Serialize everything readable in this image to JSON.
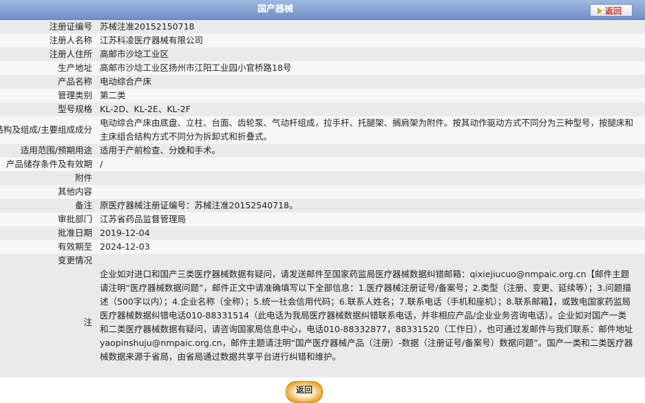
{
  "header": {
    "title": "国产器械",
    "back_label": "返回"
  },
  "fields": {
    "reg_no": {
      "label": "注册证编号",
      "value": "苏械注准20152150718"
    },
    "registrant": {
      "label": "注册人名称",
      "value": "江苏科凌医疗器械有限公司"
    },
    "address": {
      "label": "注册人住所",
      "value": "高邮市沙埝工业区"
    },
    "production": {
      "label": "生产地址",
      "value": "高邮市沙埝工业区扬州市江阳工业园小官桥路18号"
    },
    "product": {
      "label": "产品名称",
      "value": "电动综合产床"
    },
    "category": {
      "label": "管理类别",
      "value": "第二类"
    },
    "model": {
      "label": "型号规格",
      "value": "KL-2D、KL-2E、KL-2F"
    },
    "composition": {
      "label": "结构及组成/主要组成成分",
      "value": "电动综合产床由底盘、立柱、台面、齿轮泵、气动杆组成，拉手杆、托腿架、搁肩架为附件。按其动作驱动方式不同分为三种型号，按腿床和主床组合结构方式不同分为拆卸式和折叠式。"
    },
    "scope": {
      "label": "适用范围/预期用途",
      "value": "适用于产前检查、分娩和手术。"
    },
    "storage": {
      "label": "产品储存条件及有效期",
      "value": "/"
    },
    "attachment": {
      "label": "附件",
      "value": ""
    },
    "other": {
      "label": "其他内容",
      "value": ""
    },
    "remark": {
      "label": "备注",
      "value": "原医疗器械注册证编号：苏械注准20152540718。"
    },
    "authority": {
      "label": "审批部门",
      "value": "江苏省药品监督管理局"
    },
    "approval_date": {
      "label": "批准日期",
      "value": "2019-12-04"
    },
    "valid_until": {
      "label": "有效期至",
      "value": "2024-12-03"
    },
    "changes": {
      "label": "变更情况",
      "value": ""
    },
    "note": {
      "label": "注",
      "value": "企业如对进口和国产三类医疗器械数据有疑问，请发送邮件至国家药监局医疗器械数据纠错邮箱：qixiejiucuo@nmpaic.org.cn【邮件主题请注明“医疗器械数据问题”，邮件正文中请准确填写以下全部信息：1.医疗器械注册证号/备案号；2.类型（注册、变更、延续等）；3.问题描述（500字以内）；4.企业名称（全称）；5.统一社会信用代码；6.联系人姓名；7.联系电话（手机和座机）；8.联系邮箱】，或致电国家药监局医疗器械数据纠错电话010-88331514（此电话为我局医疗器械数据纠错联系电话，并非相应产品/企业业务咨询电话）。企业如对国产一类和二类医疗器械数据有疑问，请咨询国家局信息中心，电话010-88332877，88331520（工作日），也可通过发邮件与我们联系：邮件地址yaopinshuju@nmpaic.org.cn，邮件主题请注明“国产医疗器械产品（注册）-数据（注册证号/备案号）数据问题”。国产一类和二类医疗器械数据来源于省局，由省局通过数据共享平台进行纠错和维护。"
    }
  },
  "bottom": {
    "back_label": "返回"
  },
  "colors": {
    "header": "#7b98cf",
    "row_shade": "#eaeaea",
    "row_plain": "#f7f7f7"
  }
}
